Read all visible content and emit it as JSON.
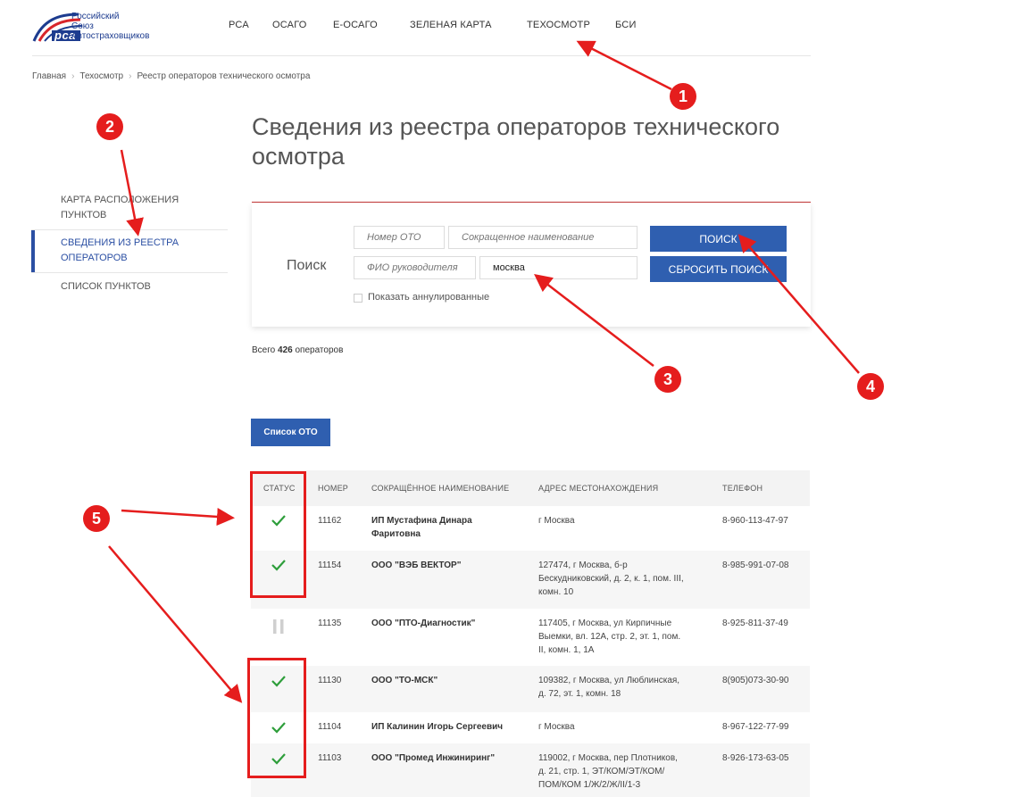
{
  "brand": {
    "logo_mark": "рса",
    "name_line1": "Российский",
    "name_line2": "Союз",
    "name_line3": "Автостраховщиков"
  },
  "nav": {
    "items": [
      "РСА",
      "ОСАГО",
      "Е-ОСАГО",
      "ЗЕЛЕНАЯ КАРТА",
      "ТЕХОСМОТР",
      "БСИ"
    ]
  },
  "breadcrumb": [
    "Главная",
    "Техосмотр",
    "Реестр операторов технического осмотра"
  ],
  "sidebar": {
    "items": [
      {
        "label_line1": "КАРТА РАСПОЛОЖЕНИЯ",
        "label_line2": "ПУНКТОВ"
      },
      {
        "label_line1": "СВЕДЕНИЯ ИЗ РЕЕСТРА",
        "label_line2": "ОПЕРАТОРОВ"
      },
      {
        "label_line1": "СПИСОК ПУНКТОВ",
        "label_line2": ""
      }
    ]
  },
  "page": {
    "title_line1": "Сведения из реестра операторов технического",
    "title_line2": "осмотра"
  },
  "search": {
    "label": "Поиск",
    "oto_number_placeholder": "Номер ОТО",
    "short_name_placeholder": "Сокращенное наименование",
    "director_placeholder": "ФИО руководителя",
    "city_value": "москва",
    "search_button": "ПОИСК",
    "reset_button": "СБРОСИТЬ ПОИСК",
    "show_annulled_label": "Показать аннулированные"
  },
  "results": {
    "total_prefix": "Всего",
    "total_count": "426",
    "total_suffix": "операторов",
    "list_button": "Список ОТО"
  },
  "table": {
    "headers": [
      "СТАТУС",
      "НОМЕР",
      "СОКРАЩЁННОЕ НАИМЕНОВАНИЕ",
      "АДРЕС МЕСТОНАХОЖДЕНИЯ",
      "ТЕЛЕФОН"
    ],
    "rows": [
      {
        "status": "active",
        "number": "11162",
        "name_line1": "ИП Мустафина Динара",
        "name_line2": "Фаритовна",
        "addr_line1": "г Москва",
        "addr_line2": "",
        "addr_line3": "",
        "phone": "8-960-113-47-97"
      },
      {
        "status": "active",
        "number": "11154",
        "name_line1": "ООО \"ВЭБ ВЕКТОР\"",
        "name_line2": "",
        "addr_line1": "127474, г Москва, б-р",
        "addr_line2": "Бескудниковский, д. 2, к. 1, пом. III,",
        "addr_line3": "комн. 10",
        "phone": "8-985-991-07-08"
      },
      {
        "status": "paused",
        "number": "11135",
        "name_line1": "ООО \"ПТО-Диагностик\"",
        "name_line2": "",
        "addr_line1": "117405, г Москва, ул Кирпичные",
        "addr_line2": "Выемки, вл. 12А, стр. 2, эт. 1, пом.",
        "addr_line3": "II, комн. 1, 1А",
        "phone": "8-925-811-37-49"
      },
      {
        "status": "active",
        "number": "11130",
        "name_line1": "ООО \"ТО-МСК\"",
        "name_line2": "",
        "addr_line1": "109382, г Москва, ул Люблинская,",
        "addr_line2": "д. 72, эт. 1, комн. 18",
        "addr_line3": "",
        "phone": "8(905)073-30-90"
      },
      {
        "status": "active",
        "number": "11104",
        "name_line1": "ИП Калинин Игорь Сергеевич",
        "name_line2": "",
        "addr_line1": "г Москва",
        "addr_line2": "",
        "addr_line3": "",
        "phone": "8-967-122-77-99"
      },
      {
        "status": "active",
        "number": "11103",
        "name_line1": "ООО \"Промед Инжиниринг\"",
        "name_line2": "",
        "addr_line1": "119002, г Москва, пер Плотников,",
        "addr_line2": "д. 21, стр. 1, ЭТ/КОМ/ЭТ/КОМ/",
        "addr_line3": "ПОМ/КОМ 1/Ж/2/Ж/II/1-3",
        "phone": "8-926-173-63-05"
      }
    ]
  },
  "annotations": {
    "badges": [
      "1",
      "2",
      "3",
      "4",
      "5"
    ]
  },
  "colors": {
    "accent_blue": "#2f5fb0",
    "active_green": "#2e9e3b",
    "annotation_red": "#e51d1d",
    "title_rule": "#c53838"
  }
}
